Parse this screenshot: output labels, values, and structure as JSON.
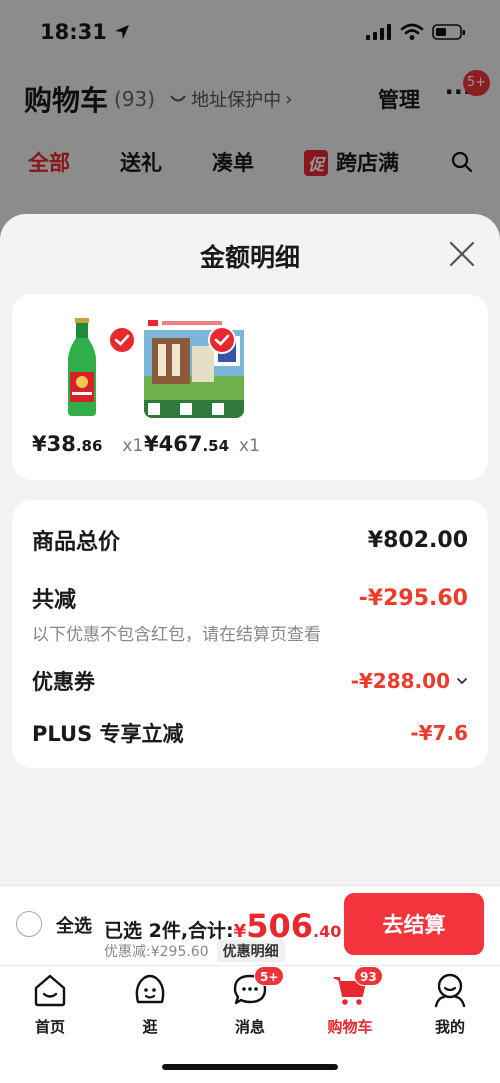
{
  "status_bar": {
    "time": "18:31"
  },
  "background_page": {
    "title": "购物车",
    "count": "(93)",
    "address_protect": "地址保护中",
    "manage": "管理",
    "more_badge": "5+",
    "tabs": [
      "全部",
      "送礼",
      "凑单",
      "跨店满"
    ],
    "promo_tag": "促"
  },
  "sheet": {
    "title": "金额明细",
    "products": [
      {
        "name": "西凤酒绿瓶",
        "price_main": "¥38",
        "price_dec": ".86",
        "qty": "x1"
      },
      {
        "name": "西凤酒礼盒",
        "price_main": "¥467",
        "price_dec": ".54",
        "qty": "x1"
      }
    ],
    "summary": {
      "total_label": "商品总价",
      "total_value": "¥802.00",
      "reduce_label": "共减",
      "reduce_value": "-¥295.60",
      "reduce_note": "以下优惠不包含红包，请在结算页查看",
      "coupon_label": "优惠券",
      "coupon_value": "-¥288.00",
      "plus_label": "PLUS 专享立减",
      "plus_value": "-¥7.6"
    }
  },
  "checkout": {
    "select_all": "全选",
    "selected_text": "已选 2件,合计:",
    "currency": "¥",
    "total_main": "506",
    "total_dec": ".40",
    "discount_text": "优惠减:¥295.60",
    "detail_label": "优惠明细",
    "button": "去结算"
  },
  "tab_bar": {
    "items": [
      {
        "label": "首页",
        "icon": "home-icon"
      },
      {
        "label": "逛",
        "icon": "browse-face-icon"
      },
      {
        "label": "消息",
        "icon": "message-icon",
        "badge": "5+"
      },
      {
        "label": "购物车",
        "icon": "cart-icon",
        "badge": "93"
      },
      {
        "label": "我的",
        "icon": "profile-icon"
      }
    ]
  },
  "colors": {
    "accent": "#e8282d",
    "discount": "#ec3c2c"
  }
}
